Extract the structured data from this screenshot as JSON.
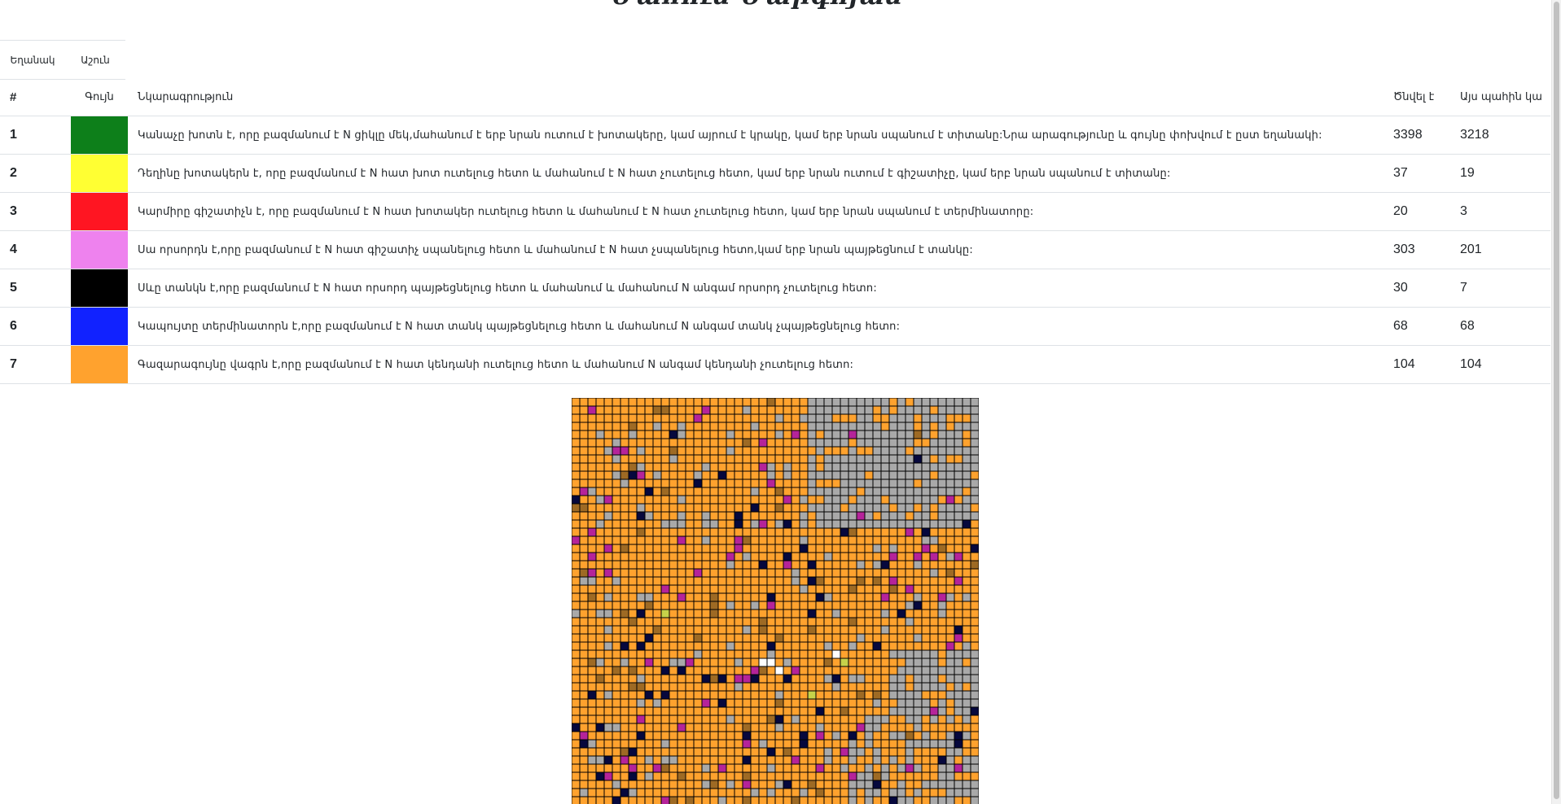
{
  "page": {
    "title": "Մահուն Մարգոյան"
  },
  "mode_tabs": {
    "mode_label": "Եղանակ",
    "step_label": "Աշուն"
  },
  "table": {
    "headers": {
      "num": "#",
      "color": "Գույն",
      "description": "Նկարագրություն",
      "born": "Ծնվել է",
      "alive": "Այս պահին կա"
    },
    "rows": [
      {
        "num": "1",
        "color": "#0d7f1a",
        "description": "Կանաչը խոտն է, որը բազմանում է N ցիկլը մեկ,մահանում է երբ նրան ուտում է խոտակերը, կամ այրում է կրակը, կամ երբ նրան սպանում է տիտանը:Նրա արագությունը և գույնը փոխվում է ըստ եղանակի:",
        "born": "3398",
        "alive": "3218"
      },
      {
        "num": "2",
        "color": "#ffff33",
        "description": "Դեղինը խոտակերն է, որը բազմանում է N հատ խոտ ուտելուց հետո և մահանում է N հատ չուտելուց հետո, կամ երբ նրան ուտում է գիշատիչը, կամ երբ նրան սպանում է տիտանը:",
        "born": "37",
        "alive": "19"
      },
      {
        "num": "3",
        "color": "#ff1522",
        "description": "Կարմիրը գիշատիչն է, որը բազմանում է N հատ խոտակեր ուտելուց հետո և մահանում է N հատ չուտելուց հետո, կամ երբ նրան սպանում է տերմինատորը:",
        "born": "20",
        "alive": "3"
      },
      {
        "num": "4",
        "color": "#ee82ee",
        "description": "Սա որսորդն է,որը բազմանում է N հատ գիշատիչ սպանելուց հետո և մահանում է N հատ չսպանելուց հետո,կամ երբ նրան պայթեցնում է տանկը:",
        "born": "303",
        "alive": "201"
      },
      {
        "num": "5",
        "color": "#000000",
        "description": "Սևը տանկն է,որը բազմանում է N հատ որսորդ պայթեցնելուց հետո և մահանում և մահանում N անգամ որսորդ չուտելուց հետո:",
        "born": "30",
        "alive": "7"
      },
      {
        "num": "6",
        "color": "#1122ff",
        "description": "Կապույտը տերմինատորն է,որը բազմանում է N հատ տանկ պայթեցնելուց հետո և մահանում N անգամ տանկ չպայթեցնելուց հետո:",
        "born": "68",
        "alive": "68"
      },
      {
        "num": "7",
        "color": "#ffa22e",
        "description": "Գազարագույնը վագրն է,որը բազմանում է N հատ կենդանի ուտելուց հետո և մահանում N անգամ կենդանի չուտելուց հետո:",
        "born": "104",
        "alive": "104"
      }
    ]
  },
  "matrix": {
    "palette": {
      "orange": "#ffa22e",
      "gray": "#a9a9a9",
      "magenta": "#b5239a",
      "navy": "#06083d",
      "brown": "#9e6a24",
      "yellowgreen": "#c6d24a",
      "white": "#ffffff",
      "border": "#000000"
    }
  }
}
